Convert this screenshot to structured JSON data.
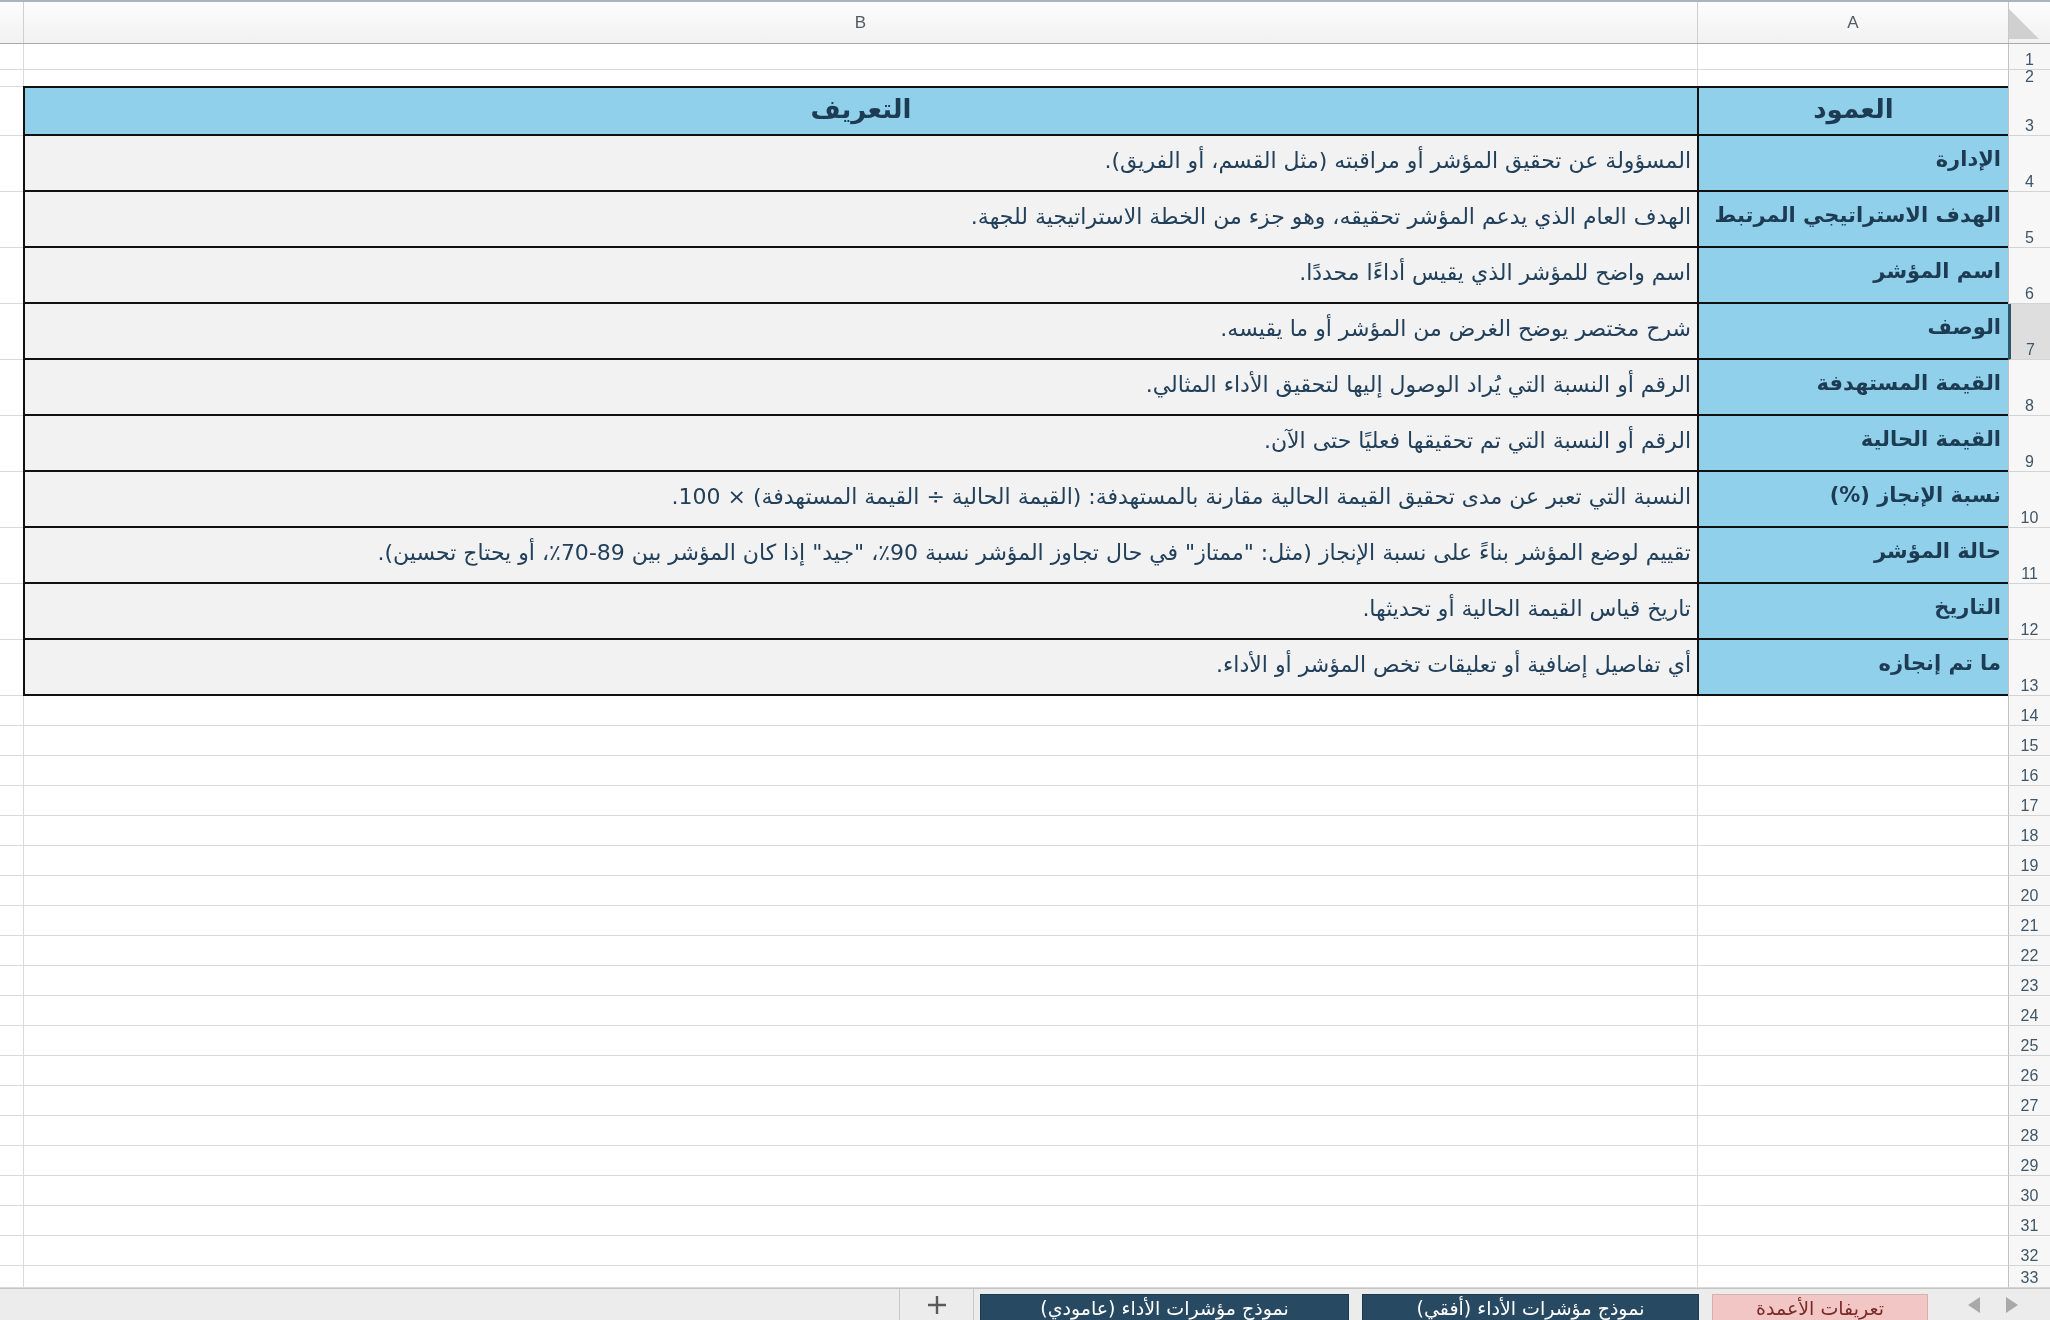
{
  "column_letters": [
    "A",
    "B"
  ],
  "table": {
    "columns": [
      "العمود",
      "التعريف"
    ],
    "rows": [
      {
        "cells": [
          "الإدارة",
          "المسؤولة عن تحقيق المؤشر أو مراقبته (مثل القسم، أو الفريق)."
        ]
      },
      {
        "cells": [
          "الهدف الاستراتيجي المرتبط",
          "الهدف العام الذي يدعم المؤشر تحقيقه، وهو جزء من الخطة الاستراتيجية للجهة."
        ]
      },
      {
        "cells": [
          "اسم المؤشر",
          "اسم واضح للمؤشر الذي يقيس أداءًا محددًا."
        ]
      },
      {
        "cells": [
          "الوصف",
          "شرح مختصر يوضح الغرض من المؤشر أو ما يقيسه."
        ]
      },
      {
        "cells": [
          "القيمة المستهدفة",
          "الرقم أو النسبة التي يُراد الوصول إليها لتحقيق الأداء المثالي."
        ]
      },
      {
        "cells": [
          "القيمة الحالية",
          "الرقم أو النسبة التي تم تحقيقها فعليًا حتى الآن."
        ]
      },
      {
        "cells": [
          "نسبة الإنجاز (%)",
          "النسبة التي تعبر عن مدى تحقيق القيمة الحالية مقارنة بالمستهدفة: (القيمة الحالية ÷ القيمة المستهدفة) × 100."
        ]
      },
      {
        "cells": [
          "حالة المؤشر",
          "تقييم لوضع المؤشر بناءً على نسبة الإنجاز (مثل: \"ممتاز\" في حال تجاوز المؤشر نسبة 90٪، \"جيد\" إذا كان المؤشر بين 89-70٪، أو يحتاج تحسين)."
        ]
      },
      {
        "cells": [
          "التاريخ",
          "تاريخ قياس القيمة الحالية أو تحديثها."
        ]
      },
      {
        "cells": [
          "ما تم إنجازه",
          "أي تفاصيل إضافية أو تعليقات تخص المؤشر أو الأداء."
        ]
      }
    ]
  },
  "row_numbers": [
    {
      "label": "1",
      "selected": false
    },
    {
      "label": "2",
      "selected": false
    },
    {
      "label": "3",
      "selected": false
    },
    {
      "label": "4",
      "selected": false
    },
    {
      "label": "5",
      "selected": false
    },
    {
      "label": "6",
      "selected": false
    },
    {
      "label": "7",
      "selected": true
    },
    {
      "label": "8",
      "selected": false
    },
    {
      "label": "9",
      "selected": false
    },
    {
      "label": "10",
      "selected": false
    },
    {
      "label": "11",
      "selected": false
    },
    {
      "label": "12",
      "selected": false
    },
    {
      "label": "13",
      "selected": false
    },
    {
      "label": "14",
      "selected": false
    },
    {
      "label": "15",
      "selected": false
    },
    {
      "label": "16",
      "selected": false
    },
    {
      "label": "17",
      "selected": false
    },
    {
      "label": "18",
      "selected": false
    },
    {
      "label": "19",
      "selected": false
    },
    {
      "label": "20",
      "selected": false
    },
    {
      "label": "21",
      "selected": false
    },
    {
      "label": "22",
      "selected": false
    },
    {
      "label": "23",
      "selected": false
    },
    {
      "label": "24",
      "selected": false
    },
    {
      "label": "25",
      "selected": false
    },
    {
      "label": "26",
      "selected": false
    },
    {
      "label": "27",
      "selected": false
    },
    {
      "label": "28",
      "selected": false
    },
    {
      "label": "29",
      "selected": false
    },
    {
      "label": "30",
      "selected": false
    },
    {
      "label": "31",
      "selected": false
    },
    {
      "label": "32",
      "selected": false
    },
    {
      "label": "33",
      "selected": false
    }
  ],
  "sheet_tabs": [
    {
      "label": "تعريفات الأعمدة",
      "selected": true
    },
    {
      "label": "نموذج مؤشرات الأداء (أفقي)",
      "selected": false
    },
    {
      "label": "نموذج مؤشرات الأداء (عامودي)",
      "selected": false
    }
  ]
}
